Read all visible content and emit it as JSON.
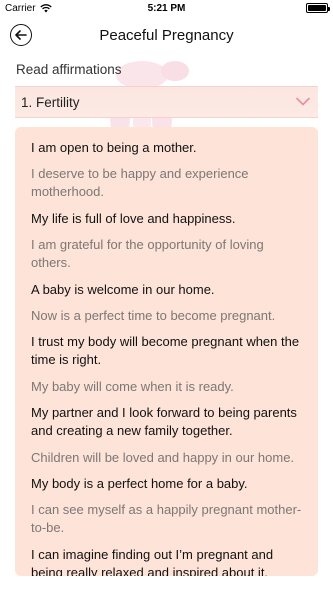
{
  "status_bar": {
    "carrier": "Carrier",
    "time": "5:21 PM"
  },
  "header": {
    "back_icon": "back-arrow-circle-icon",
    "title": "Peaceful Pregnancy"
  },
  "section": {
    "label": "Read affirmations"
  },
  "category": {
    "selected": "1. Fertility",
    "icon": "chevron-down-icon",
    "chevron_color": "#e98aa8",
    "background": "#fbe6e0"
  },
  "affirmations": [
    {
      "text": "I am open to being a mother.",
      "tone": "dark"
    },
    {
      "text": "I deserve to be happy and experience motherhood.",
      "tone": "light"
    },
    {
      "text": "My life is full of love and happiness.",
      "tone": "dark"
    },
    {
      "text": "I am grateful for the opportunity of loving others.",
      "tone": "light"
    },
    {
      "text": "A baby is welcome in our home.",
      "tone": "dark"
    },
    {
      "text": "Now is a perfect time to become pregnant.",
      "tone": "light"
    },
    {
      "text": "I trust my body will become pregnant when the time is right.",
      "tone": "dark"
    },
    {
      "text": "My baby will come when it is ready.",
      "tone": "light"
    },
    {
      "text": "My partner and I look forward to being parents and creating a new family together.",
      "tone": "dark"
    },
    {
      "text": "Children will be loved and happy in our home.",
      "tone": "light"
    },
    {
      "text": "My body is a perfect home for a baby.",
      "tone": "dark"
    },
    {
      "text": "I can see myself as a happily pregnant mother-to-be.",
      "tone": "light"
    },
    {
      "text": "I can imagine finding out I’m pregnant and being really relaxed and inspired about it.",
      "tone": "dark"
    }
  ],
  "colors": {
    "card_background": "#fde3d8",
    "dark_text": "#111111",
    "light_text": "#7d7775"
  }
}
